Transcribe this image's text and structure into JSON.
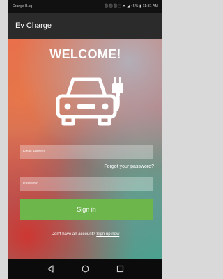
{
  "status_bar": {
    "carrier": "Orange B.sq",
    "right_text": "⚫⚫⚫⬚ ▼ ◢ 45% ▮ 11:31 AM"
  },
  "app_bar": {
    "title": "Ev Charge"
  },
  "login": {
    "welcome": "WELCOME!",
    "email_placeholder": "Email Address",
    "forgot_password": "Forgot your password?",
    "password_placeholder": "Password",
    "sign_in": "Sign in",
    "no_account": "Don't have an account?",
    "sign_up": "Sign up now"
  },
  "icons": {
    "logo": "car-charging-plug-icon",
    "nav": [
      "back-icon",
      "home-icon",
      "recents-icon"
    ]
  },
  "colors": {
    "app_bar": "#2b2b2b",
    "sign_in_button": "#6db64b",
    "background_gradient": [
      "#e86a4c",
      "#b96f6a",
      "#6e8f8c",
      "#4aa08e"
    ]
  }
}
